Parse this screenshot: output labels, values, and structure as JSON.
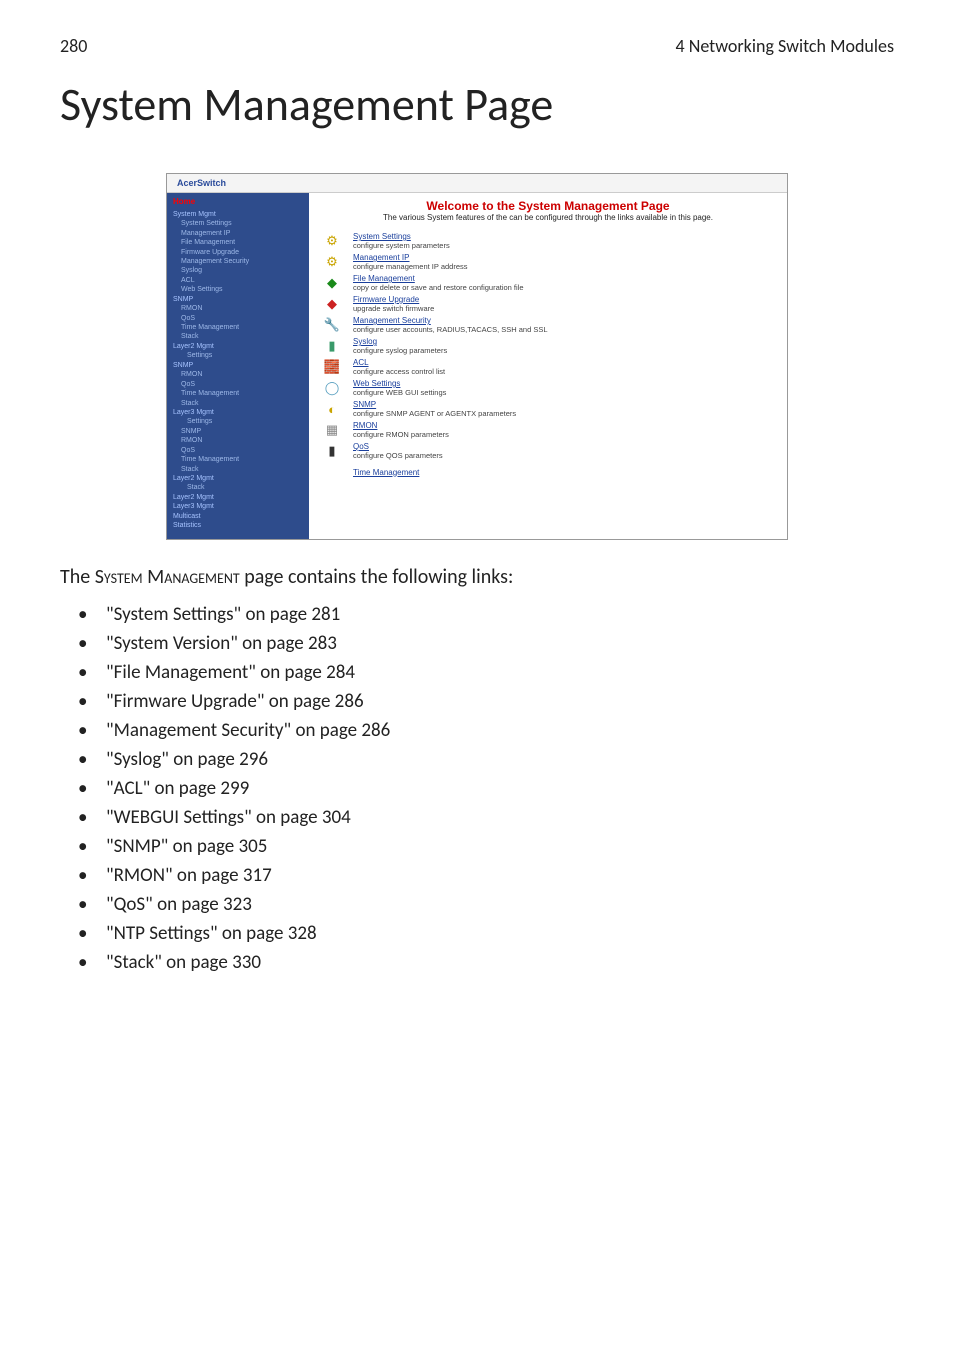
{
  "header": {
    "page_number": "280",
    "chapter": "4 Networking Switch Modules"
  },
  "title": "System Management Page",
  "screenshot": {
    "app_title": "AcerSwitch",
    "sidebar": {
      "home": "Home",
      "items": [
        {
          "label": "System Mgmt",
          "class": "top-level"
        },
        {
          "label": "System Settings",
          "class": "sub"
        },
        {
          "label": "Management IP",
          "class": "sub"
        },
        {
          "label": "File Management",
          "class": "sub"
        },
        {
          "label": "Firmware Upgrade",
          "class": "sub"
        },
        {
          "label": "Management Security",
          "class": "sub"
        },
        {
          "label": "Syslog",
          "class": "sub"
        },
        {
          "label": "ACL",
          "class": "sub"
        },
        {
          "label": "Web Settings",
          "class": "sub"
        },
        {
          "label": "SNMP",
          "class": "top-level"
        },
        {
          "label": "RMON",
          "class": "sub"
        },
        {
          "label": "QoS",
          "class": "sub"
        },
        {
          "label": "Time Management",
          "class": "sub"
        },
        {
          "label": "Stack",
          "class": "sub"
        },
        {
          "label": "Layer2 Mgmt",
          "class": "top-level"
        },
        {
          "label": "Settings",
          "class": "sub2"
        },
        {
          "label": "SNMP",
          "class": "top-level"
        },
        {
          "label": "RMON",
          "class": "sub"
        },
        {
          "label": "QoS",
          "class": "sub"
        },
        {
          "label": "Time Management",
          "class": "sub"
        },
        {
          "label": "Stack",
          "class": "sub"
        },
        {
          "label": "Layer3 Mgmt",
          "class": "top-level"
        },
        {
          "label": "Settings",
          "class": "sub2"
        },
        {
          "label": "SNMP",
          "class": "sub"
        },
        {
          "label": "RMON",
          "class": "sub"
        },
        {
          "label": "QoS",
          "class": "sub"
        },
        {
          "label": "Time Management",
          "class": "sub"
        },
        {
          "label": "Stack",
          "class": "sub"
        },
        {
          "label": "Layer2 Mgmt",
          "class": "top-level"
        },
        {
          "label": "Stack",
          "class": "sub2"
        },
        {
          "label": "Layer2 Mgmt",
          "class": "top-level"
        },
        {
          "label": "Layer3 Mgmt",
          "class": "top-level"
        },
        {
          "label": "Multicast",
          "class": "top-level"
        },
        {
          "label": "Statistics",
          "class": "top-level"
        }
      ]
    },
    "main": {
      "welcome": "Welcome to the System Management Page",
      "subtitle": "The various System features of the can be configured through the links available in this page.",
      "rows": [
        {
          "icon": "⚙",
          "color": "#c9a400",
          "link": "System Settings",
          "desc": "configure system parameters"
        },
        {
          "icon": "⚙",
          "color": "#c9a400",
          "link": "Management IP",
          "desc": "configure management IP address"
        },
        {
          "icon": "◆",
          "color": "#1a8a1a",
          "link": "File Management",
          "desc": "copy or delete or save and restore configuration file"
        },
        {
          "icon": "◆",
          "color": "#c22",
          "link": "Firmware Upgrade",
          "desc": "upgrade switch firmware"
        },
        {
          "icon": "🔧",
          "color": "#1a3f9c",
          "link": "Management Security",
          "desc": "configure user accounts, RADIUS,TACACS, SSH and SSL"
        },
        {
          "icon": "▮",
          "color": "#3a9a6a",
          "link": "Syslog",
          "desc": "configure syslog parameters"
        },
        {
          "icon": "🧱",
          "color": "#b04a1a",
          "link": "ACL",
          "desc": "configure access control list"
        },
        {
          "icon": "◯",
          "color": "#5aa0c0",
          "link": "Web Settings",
          "desc": "configure WEB GUI settings"
        },
        {
          "icon": "◐",
          "color": "#c9a400",
          "link": "SNMP",
          "desc": "configure SNMP AGENT or AGENTX parameters"
        },
        {
          "icon": "▦",
          "color": "#888",
          "link": "RMON",
          "desc": "configure RMON parameters"
        },
        {
          "icon": "▮",
          "color": "#333",
          "link": "QoS",
          "desc": "configure QOS parameters"
        },
        {
          "icon": "",
          "color": "#333",
          "link": "Time Management",
          "desc": ""
        }
      ]
    }
  },
  "intro": {
    "prefix": "The ",
    "smallcaps": "System Management",
    "suffix": " page contains the following links:"
  },
  "bullets": [
    "\"System Settings\" on page 281",
    "\"System Version\" on page 283",
    "\"File Management\" on page 284",
    "\"Firmware Upgrade\" on page 286",
    "\"Management Security\" on page 286",
    "\"Syslog\" on page 296",
    "\"ACL\" on page 299",
    "\"WEBGUI Settings\" on page 304",
    "\"SNMP\" on page 305",
    "\"RMON\" on page 317",
    "\"QoS\" on page 323",
    "\"NTP Settings\" on page 328",
    "\"Stack\" on page 330"
  ]
}
